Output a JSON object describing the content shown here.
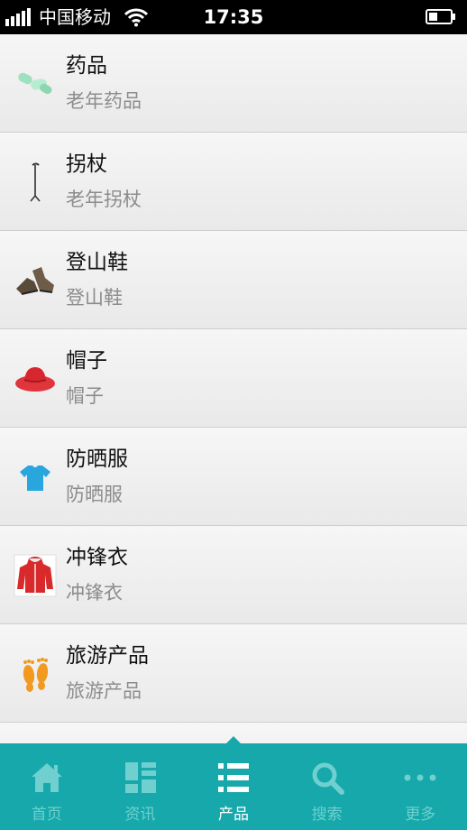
{
  "status_bar": {
    "carrier": "中国移动",
    "time": "17:35"
  },
  "products": [
    {
      "title": "药品",
      "subtitle": "老年药品",
      "icon": "pills-icon"
    },
    {
      "title": "拐杖",
      "subtitle": "老年拐杖",
      "icon": "walking-cane-icon"
    },
    {
      "title": "登山鞋",
      "subtitle": "登山鞋",
      "icon": "hiking-boots-icon"
    },
    {
      "title": "帽子",
      "subtitle": "帽子",
      "icon": "red-hat-icon"
    },
    {
      "title": "防晒服",
      "subtitle": "防晒服",
      "icon": "tshirt-icon"
    },
    {
      "title": "冲锋衣",
      "subtitle": "冲锋衣",
      "icon": "jacket-icon"
    },
    {
      "title": "旅游产品",
      "subtitle": "旅游产品",
      "icon": "footprints-icon"
    }
  ],
  "tab_bar": {
    "active": "产品",
    "tabs": [
      {
        "label": "首页",
        "icon": "home-icon"
      },
      {
        "label": "资讯",
        "icon": "news-grid-icon"
      },
      {
        "label": "产品",
        "icon": "list-icon"
      },
      {
        "label": "搜索",
        "icon": "search-icon"
      },
      {
        "label": "更多",
        "icon": "more-dots-icon"
      }
    ]
  },
  "colors": {
    "tab_bar_bg": "#16a8aa",
    "tab_label_inactive": "#6fd0cf",
    "tab_label_active": "#ffffff",
    "subtitle_gray": "#8c8c8c"
  }
}
